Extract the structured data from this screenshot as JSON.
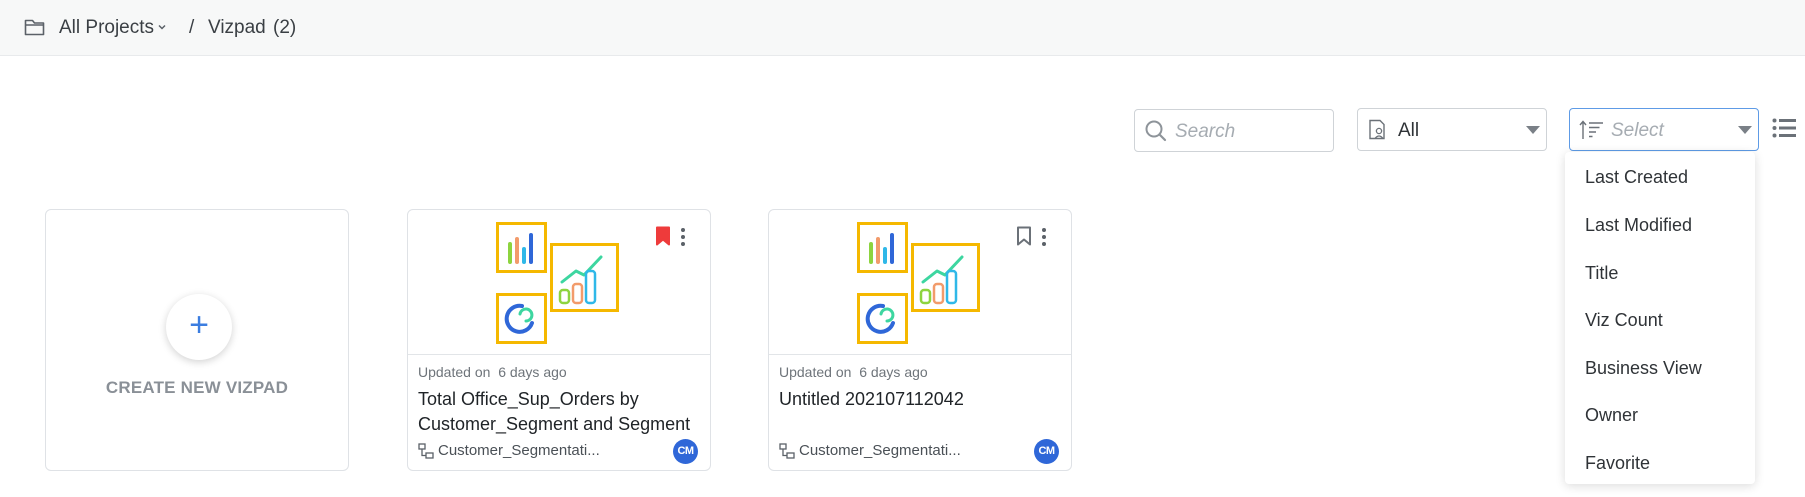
{
  "breadcrumb": {
    "root": "All Projects",
    "separator": "/",
    "current": "Vizpad",
    "count": "(2)"
  },
  "toolbar": {
    "search_placeholder": "Search",
    "filter_value": "All",
    "sort_placeholder": "Select"
  },
  "sort_menu": {
    "items": [
      "Last Created",
      "Last Modified",
      "Title",
      "Viz Count",
      "Business View",
      "Owner",
      "Favorite"
    ]
  },
  "create_card": {
    "plus": "+",
    "label": "CREATE NEW VIZPAD"
  },
  "cards": [
    {
      "updated_prefix": "Updated on",
      "updated_when": "6 days ago",
      "title": "Total Office_Sup_Orders by Customer_Segment and Segment",
      "business_view": "Customer_Segmentati...",
      "owner_initials": "CM",
      "favorite": true,
      "bookmark_color": "#ee3b3b"
    },
    {
      "updated_prefix": "Updated on",
      "updated_when": "6 days ago",
      "title": "Untitled 202107112042",
      "business_view": "Customer_Segmentati...",
      "owner_initials": "CM",
      "favorite": false,
      "bookmark_color": "#6b7178"
    }
  ],
  "colors": {
    "accent": "#2f67d8",
    "thumb_frame": "#f5b800",
    "favorite": "#ee3b3b"
  }
}
